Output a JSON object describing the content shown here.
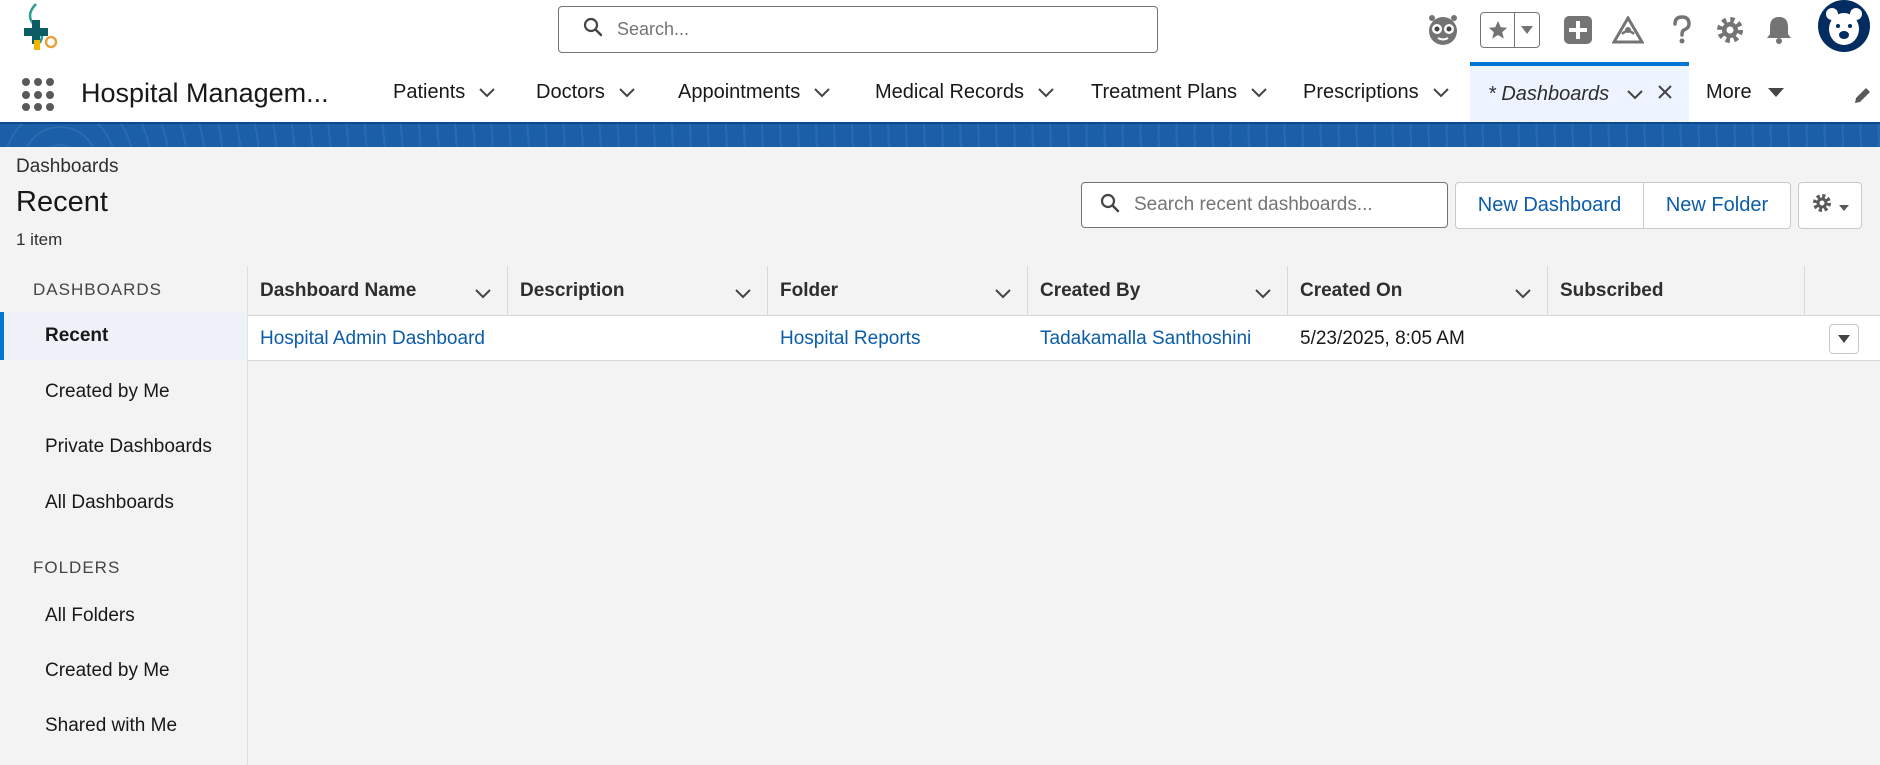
{
  "header": {
    "search_placeholder": "Search...",
    "icons": [
      "logo",
      "einstein-icon",
      "favorites-star-icon",
      "favorites-menu-icon",
      "global-add-icon",
      "trailhead-icon",
      "help-icon",
      "setup-gear-icon",
      "notifications-bell-icon",
      "avatar"
    ]
  },
  "nav": {
    "app_name": "Hospital Managem...",
    "items": [
      {
        "label": "Patients"
      },
      {
        "label": "Doctors"
      },
      {
        "label": "Appointments"
      },
      {
        "label": "Medical Records"
      },
      {
        "label": "Treatment Plans"
      },
      {
        "label": "Prescriptions"
      },
      {
        "label": "* Dashboards",
        "active": true
      },
      {
        "label": "More"
      }
    ]
  },
  "page": {
    "breadcrumb": "Dashboards",
    "title": "Recent",
    "count": "1 item",
    "search_placeholder": "Search recent dashboards...",
    "new_dashboard": "New Dashboard",
    "new_folder": "New Folder"
  },
  "sidebar": {
    "dashboards_label": "DASHBOARDS",
    "dashboards_items": [
      "Recent",
      "Created by Me",
      "Private Dashboards",
      "All Dashboards"
    ],
    "folders_label": "FOLDERS",
    "folders_items": [
      "All Folders",
      "Created by Me",
      "Shared with Me"
    ]
  },
  "table": {
    "columns": [
      "Dashboard Name",
      "Description",
      "Folder",
      "Created By",
      "Created On",
      "Subscribed"
    ],
    "rows": [
      {
        "name": "Hospital Admin Dashboard",
        "description": "",
        "folder": "Hospital Reports",
        "created_by": "Tadakamalla Santhoshini",
        "created_on": "5/23/2025, 8:05 AM",
        "subscribed": ""
      }
    ]
  },
  "colors": {
    "brand_blue": "#0176d3",
    "link_blue": "#0b5cab",
    "band_blue": "#1b5fa8"
  }
}
